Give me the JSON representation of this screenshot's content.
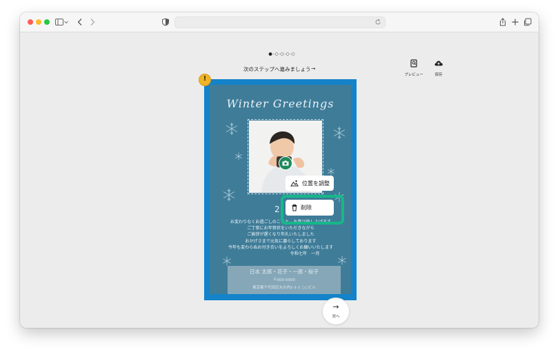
{
  "browser": {
    "traffic_lights": {
      "close": "#ff5f57",
      "minimize": "#febc2e",
      "zoom": "#28c840"
    },
    "icons": [
      "sidebar-icon",
      "chevron-down-icon",
      "back-icon",
      "forward-icon",
      "shield-icon",
      "reload-icon",
      "share-icon",
      "new-tab-icon",
      "tabs-overview-icon"
    ]
  },
  "editor": {
    "step_label": "次のステップへ進みましょう",
    "step_arrow": "→",
    "steps_total": 5,
    "steps_current": 1,
    "preview_label": "プレビュー",
    "save_label": "保存",
    "next_label": "次へ",
    "next_arrow": "→",
    "warning_glyph": "!"
  },
  "card": {
    "title": "Winter Greetings",
    "year_visible": "2",
    "message_lines": [
      "お変わりなくお過ごしのことと　お喜び申し上げます",
      "ご丁寧にお年賀状をいただきながら",
      "ご挨拶が遅くなり失礼いたしました",
      "おかげさまで元気に暮らしております",
      "今年も変わらぬお付き合いをよろしくお願いいたします",
      "令和七年　一月"
    ],
    "sender_name": "日本 太郎・花子・一郎・桜子",
    "sender_postal": "〒000-0000",
    "sender_address": "東京都千代田区丸の内1-1-1 ○○ビル",
    "colors": {
      "frame": "#1483c9",
      "card": "#3f7c98",
      "highlight": "#16b88a"
    }
  },
  "context_menu": {
    "adjust_label": "位置を調整",
    "delete_label": "削除"
  }
}
